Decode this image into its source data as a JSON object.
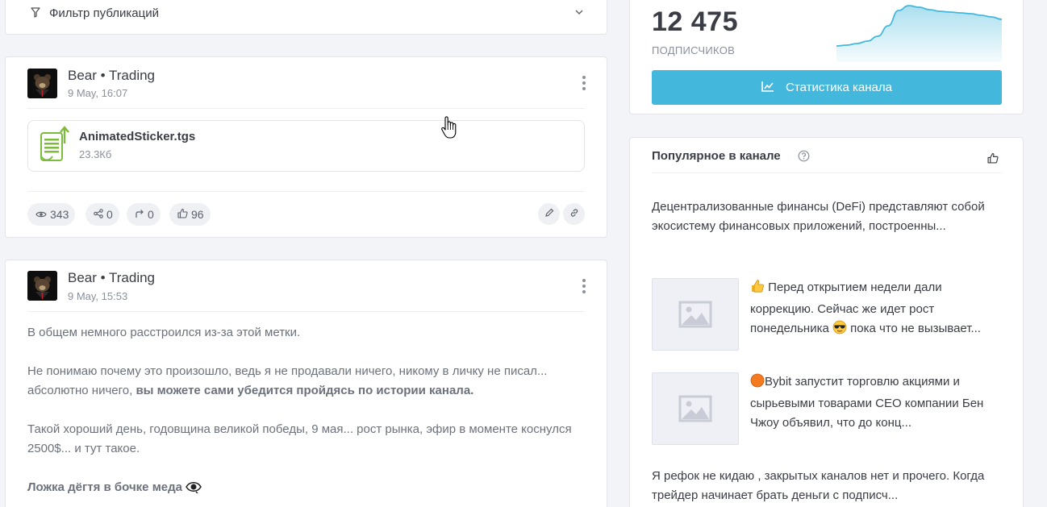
{
  "filter": {
    "label": "Фильтр публикаций"
  },
  "posts": [
    {
      "channel": "Bear • Trading",
      "date": "9 May, 16:07",
      "file": {
        "name": "AnimatedSticker.tgs",
        "size": "23.3Кб"
      },
      "stats": {
        "views": "343",
        "shares": "0",
        "forwards": "0",
        "likes": "96"
      }
    },
    {
      "channel": "Bear • Trading",
      "date": "9 May, 15:53",
      "paragraphs": [
        "В общем немного расстроился из-за этой метки.",
        "Не понимаю почему это произошло, ведь я не продавали ничего, никому в личку не писал... абсолютно ничего,",
        "вы можете сами убедится пройдясь по истории канала.",
        "Такой хороший день, годовщина великой победы, 9 мая... рост рынка, эфир в моменте коснулся 2500$... и тут такое.",
        "Ложка дёгтя в бочке меда"
      ]
    }
  ],
  "subscribers": {
    "count": "12 475",
    "label": "ПОДПИСЧИКОВ",
    "button": "Статистика канала",
    "trend": [
      20,
      21,
      23,
      26,
      32,
      45,
      64,
      70,
      68,
      65,
      63,
      62,
      61,
      60,
      58,
      56,
      53
    ],
    "color": "#44b8dc"
  },
  "popular": {
    "title": "Популярное в канале",
    "items": [
      {
        "text": "Децентрализованные финансы (DeFi) представляют собой экосистему финансовых приложений, построенны..."
      },
      {
        "text_a": "Перед открытием недели дали коррекцию. Сейчас же идет рост понедельника",
        "text_b": "пока что не вызывает..."
      },
      {
        "text": "Bybit запустит торговлю акциями и сырьевыми товарами CEO компании Бен Чжоу объявил, что до конц..."
      },
      {
        "text": "Я рефок не кидаю , закрытых каналов нет и прочего. Когда трейдер начинает брать деньги с подписч..."
      }
    ]
  }
}
